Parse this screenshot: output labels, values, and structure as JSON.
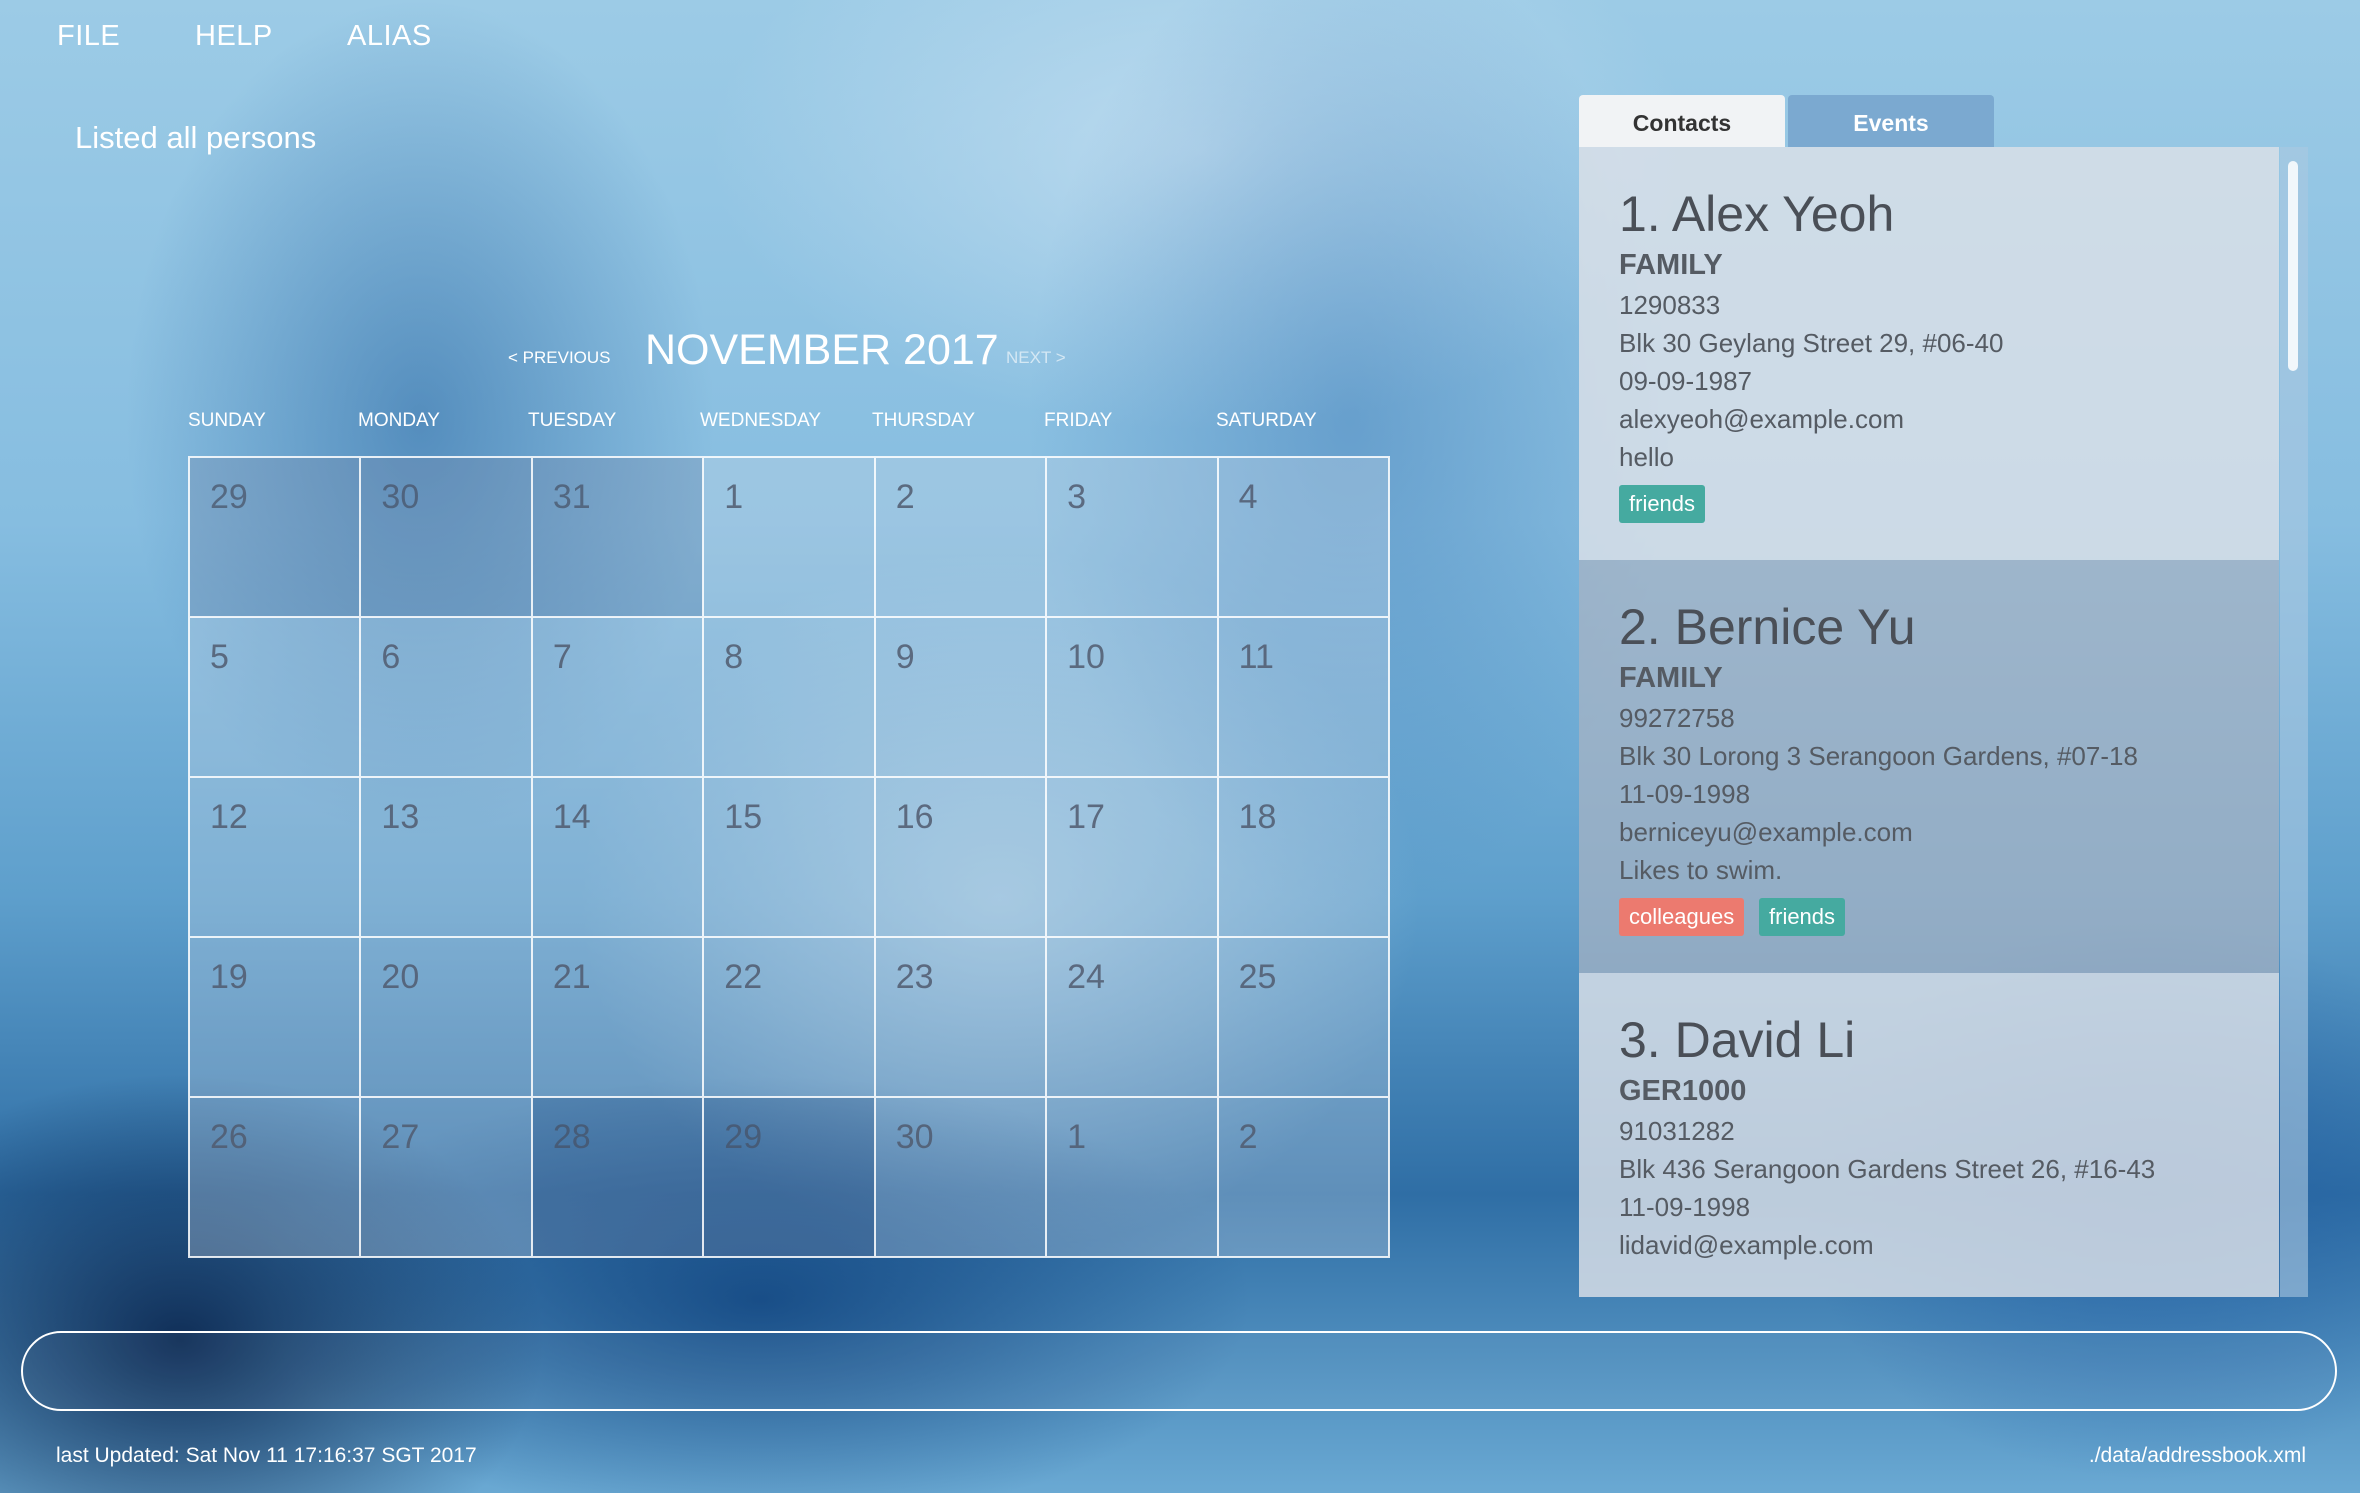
{
  "menu": {
    "file": "FILE",
    "help": "HELP",
    "alias": "ALIAS"
  },
  "result_display": "Listed all persons",
  "calendar": {
    "title": "NOVEMBER 2017",
    "prev": "< PREVIOUS",
    "next": "NEXT >",
    "days_of_week": [
      "SUNDAY",
      "MONDAY",
      "TUESDAY",
      "WEDNESDAY",
      "THURSDAY",
      "FRIDAY",
      "SATURDAY"
    ],
    "weeks": [
      [
        "29",
        "30",
        "31",
        "1",
        "2",
        "3",
        "4"
      ],
      [
        "5",
        "6",
        "7",
        "8",
        "9",
        "10",
        "11"
      ],
      [
        "12",
        "13",
        "14",
        "15",
        "16",
        "17",
        "18"
      ],
      [
        "19",
        "20",
        "21",
        "22",
        "23",
        "24",
        "25"
      ],
      [
        "26",
        "27",
        "28",
        "29",
        "30",
        "1",
        "2"
      ]
    ]
  },
  "tabs": {
    "contacts": "Contacts",
    "events": "Events"
  },
  "contacts": [
    {
      "name": "1. Alex Yeoh",
      "alias": "FAMILY",
      "phone": "1290833",
      "address": "Blk 30 Geylang Street 29, #06-40",
      "birthday": "09-09-1987",
      "email": "alexyeoh@example.com",
      "remark": "hello",
      "tags": [
        "friends"
      ]
    },
    {
      "name": "2. Bernice Yu",
      "alias": "FAMILY",
      "phone": "99272758",
      "address": "Blk 30 Lorong 3 Serangoon Gardens, #07-18",
      "birthday": "11-09-1998",
      "email": "berniceyu@example.com",
      "remark": "Likes to swim.",
      "tags": [
        "colleagues",
        "friends"
      ]
    },
    {
      "name": "3. David Li",
      "alias": "GER1000",
      "phone": "91031282",
      "address": "Blk 436 Serangoon Gardens Street 26, #16-43",
      "birthday": "11-09-1998",
      "email": "lidavid@example.com"
    }
  ],
  "command_box": {
    "value": ""
  },
  "status": {
    "last_updated": "last Updated: Sat Nov 11 17:16:37 SGT 2017",
    "file_path": "./data/addressbook.xml"
  },
  "colors": {
    "tag_friends": "#45aaa0",
    "tag_colleagues": "#ec7a6f"
  }
}
